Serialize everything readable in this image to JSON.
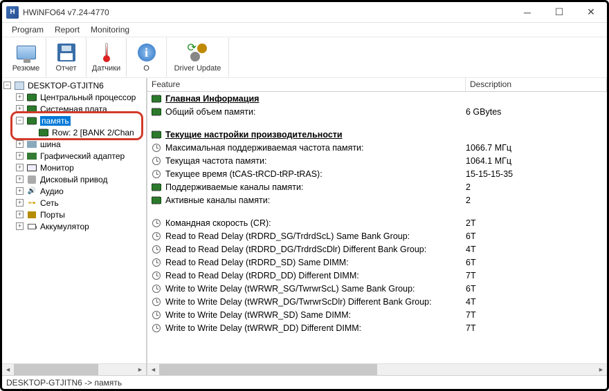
{
  "window": {
    "title": "HWiNFO64 v7.24-4770"
  },
  "menu": {
    "program": "Program",
    "report": "Report",
    "monitoring": "Monitoring"
  },
  "toolbar": {
    "resume": "Резюме",
    "report": "Отчет",
    "sensors": "Датчики",
    "about": "О",
    "driver": "Driver Update"
  },
  "tree": {
    "root": "DESKTOP-GTJITN6",
    "cpu": "Центральный процессор",
    "mobo": "Системная плата",
    "memory": "память",
    "memory_row": "Row: 2 [BANK 2/Chan",
    "bus": "шина",
    "gpu": "Графический адаптер",
    "monitor": "Монитор",
    "drive": "Дисковый привод",
    "audio": "Аудио",
    "network": "Сеть",
    "ports": "Порты",
    "battery": "Аккумулятор"
  },
  "columns": {
    "feature": "Feature",
    "description": "Description"
  },
  "sections": {
    "general": "Главная Информация",
    "perf": "Текущие настройки производительности"
  },
  "rows": {
    "total_mem": {
      "f": "Общий объем памяти:",
      "d": "6 GBytes"
    },
    "max_freq": {
      "f": "Максимальная поддерживаемая частота памяти:",
      "d": "1066.7 МГц"
    },
    "cur_freq": {
      "f": "Текущая частота памяти:",
      "d": "1064.1 МГц"
    },
    "timing": {
      "f": "Текущее время (tCAS-tRCD-tRP-tRAS):",
      "d": "15-15-15-35"
    },
    "channels_sup": {
      "f": "Поддерживаемые каналы памяти:",
      "d": "2"
    },
    "channels_act": {
      "f": "Активные каналы памяти:",
      "d": "2"
    },
    "cr": {
      "f": "Командная скорость (CR):",
      "d": "2T"
    },
    "rdrd_sg": {
      "f": "Read to Read Delay (tRDRD_SG/TrdrdScL) Same Bank Group:",
      "d": "6T"
    },
    "rdrd_dg": {
      "f": "Read to Read Delay (tRDRD_DG/TrdrdScDlr) Different Bank Group:",
      "d": "4T"
    },
    "rdrd_sd": {
      "f": "Read to Read Delay (tRDRD_SD) Same DIMM:",
      "d": "6T"
    },
    "rdrd_dd": {
      "f": "Read to Read Delay (tRDRD_DD) Different DIMM:",
      "d": "7T"
    },
    "wrwr_sg": {
      "f": "Write to Write Delay (tWRWR_SG/TwrwrScL) Same Bank Group:",
      "d": "6T"
    },
    "wrwr_dg": {
      "f": "Write to Write Delay (tWRWR_DG/TwrwrScDlr) Different Bank Group:",
      "d": "4T"
    },
    "wrwr_sd": {
      "f": "Write to Write Delay (tWRWR_SD) Same DIMM:",
      "d": "7T"
    },
    "wrwr_dd": {
      "f": "Write to Write Delay (tWRWR_DD) Different DIMM:",
      "d": "7T"
    }
  },
  "status": "DESKTOP-GTJITN6 -> память"
}
